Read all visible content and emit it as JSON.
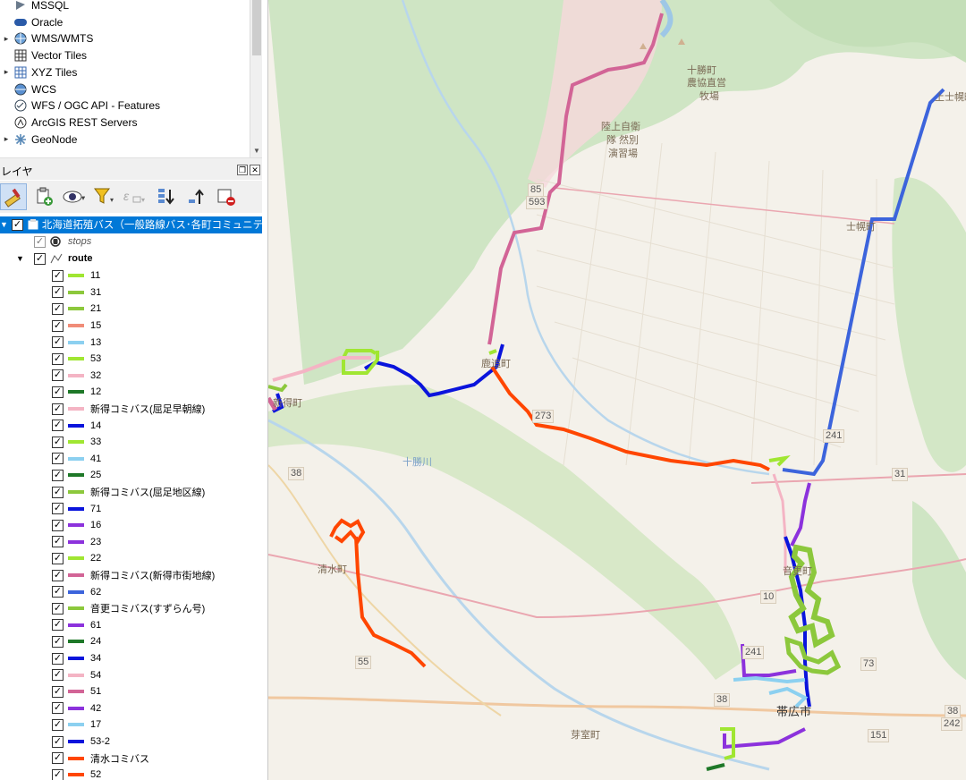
{
  "browser": {
    "items": [
      {
        "label": "MSSQL",
        "icon": "mssql-icon",
        "expand": false
      },
      {
        "label": "Oracle",
        "icon": "oracle-icon",
        "expand": false
      },
      {
        "label": "WMS/WMTS",
        "icon": "globe-icon",
        "expand": true
      },
      {
        "label": "Vector Tiles",
        "icon": "grid-icon",
        "expand": false
      },
      {
        "label": "XYZ Tiles",
        "icon": "xyz-grid-icon",
        "expand": true
      },
      {
        "label": "WCS",
        "icon": "wcs-globe-icon",
        "expand": false
      },
      {
        "label": "WFS / OGC API - Features",
        "icon": "wfs-icon",
        "expand": false
      },
      {
        "label": "ArcGIS REST Servers",
        "icon": "arcgis-icon",
        "expand": false
      },
      {
        "label": "GeoNode",
        "icon": "geonode-icon",
        "expand": true
      }
    ]
  },
  "layers_panel": {
    "title": "レイヤ",
    "group_label": "北海道拓殖バス（一般路線バス･各町コミュニティ",
    "stops_label": "stops",
    "route_label": "route"
  },
  "routes": [
    {
      "name": "11",
      "color": "#a0e632"
    },
    {
      "name": "31",
      "color": "#8cc83c"
    },
    {
      "name": "21",
      "color": "#8cc83c"
    },
    {
      "name": "15",
      "color": "#f08c78"
    },
    {
      "name": "13",
      "color": "#8cd0f0"
    },
    {
      "name": "53",
      "color": "#a0e632"
    },
    {
      "name": "32",
      "color": "#f4b4c4"
    },
    {
      "name": "12",
      "color": "#1e7828"
    },
    {
      "name": "新得コミバス(屈足早朝線)",
      "color": "#f4b4c4"
    },
    {
      "name": "14",
      "color": "#0a14dc"
    },
    {
      "name": "33",
      "color": "#a0e632"
    },
    {
      "name": "41",
      "color": "#8cd0f0"
    },
    {
      "name": "25",
      "color": "#1e7828"
    },
    {
      "name": "新得コミバス(屈足地区線)",
      "color": "#8cc83c"
    },
    {
      "name": "71",
      "color": "#0a14dc"
    },
    {
      "name": "16",
      "color": "#8c32dc"
    },
    {
      "name": "23",
      "color": "#8c32dc"
    },
    {
      "name": "22",
      "color": "#a0e632"
    },
    {
      "name": "新得コミバス(新得市街地線)",
      "color": "#d26496"
    },
    {
      "name": "62",
      "color": "#3c64dc"
    },
    {
      "name": "音更コミバス(すずらん号)",
      "color": "#8cc83c"
    },
    {
      "name": "61",
      "color": "#8c32dc"
    },
    {
      "name": "24",
      "color": "#1e7828"
    },
    {
      "name": "34",
      "color": "#0a14dc"
    },
    {
      "name": "54",
      "color": "#f4b4c4"
    },
    {
      "name": "51",
      "color": "#d26496"
    },
    {
      "name": "42",
      "color": "#8c32dc"
    },
    {
      "name": "17",
      "color": "#8cd0f0"
    },
    {
      "name": "53-2",
      "color": "#0a14dc"
    },
    {
      "name": "清水コミバス",
      "color": "#ff4600"
    },
    {
      "name": "52",
      "color": "#ff4600"
    }
  ],
  "map": {
    "labels": [
      {
        "id": "jsdf",
        "text": "陸上自衛"
      },
      {
        "id": "jsdf2",
        "text": "隊 然別"
      },
      {
        "id": "jsdf3",
        "text": "演習場"
      },
      {
        "id": "farm1",
        "text": "十勝町"
      },
      {
        "id": "farm2",
        "text": "農協直営"
      },
      {
        "id": "farm3",
        "text": "牧場"
      },
      {
        "id": "shikaoi",
        "text": "鹿追町"
      },
      {
        "id": "shintoku",
        "text": "新得町"
      },
      {
        "id": "tokachigawa",
        "text": "十勝川"
      },
      {
        "id": "shimizu",
        "text": "清水町"
      },
      {
        "id": "memuro",
        "text": "芽室町"
      },
      {
        "id": "obihiro",
        "text": "帯広市"
      },
      {
        "id": "otofuke",
        "text": "音更町"
      },
      {
        "id": "shihoro",
        "text": "士幌町"
      },
      {
        "id": "kamishihoro",
        "text": "上士幌町"
      }
    ],
    "shields": [
      "85",
      "593",
      "38",
      "55",
      "273",
      "241",
      "31",
      "10",
      "38",
      "73",
      "151",
      "38",
      "242",
      "241"
    ]
  }
}
